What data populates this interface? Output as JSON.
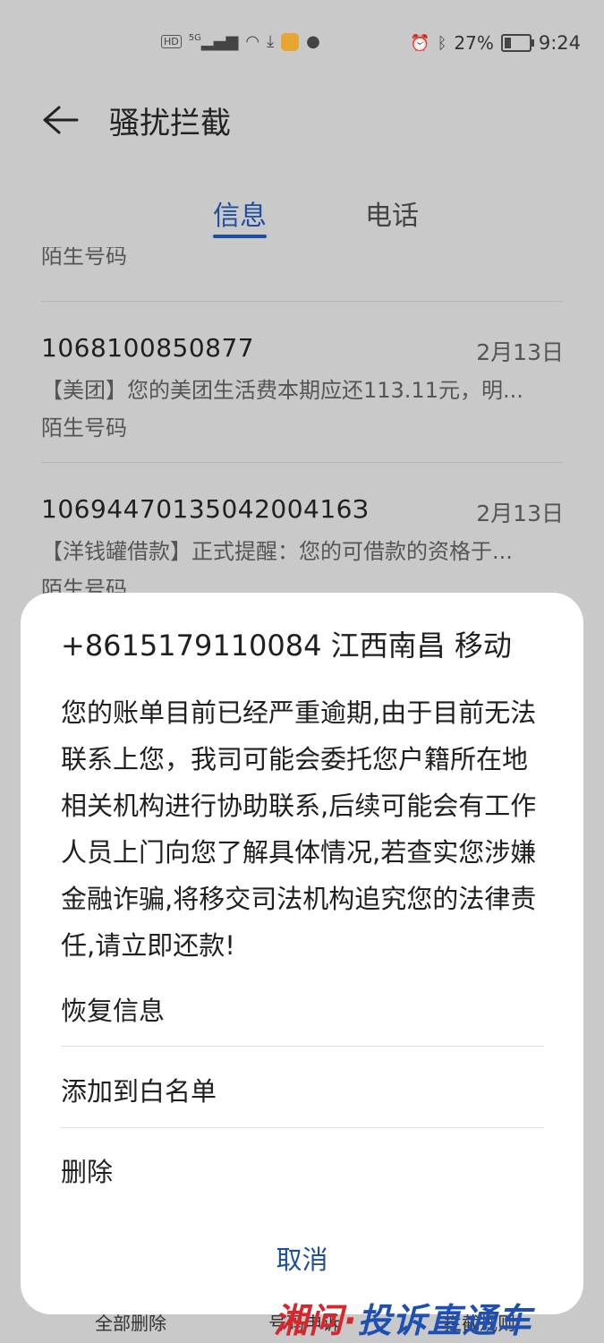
{
  "status_bar": {
    "left_icons": [
      "hd-badge",
      "5g-signal-icon",
      "wifi-icon",
      "download-icon",
      "app-notification-icon",
      "message-icon"
    ],
    "hd_label": "HD",
    "network": "5G",
    "battery_percent": "27%",
    "battery_level": 0.27,
    "time": "9:24"
  },
  "header": {
    "title": "骚扰拦截"
  },
  "tabs": [
    {
      "label": "信息",
      "selected": true
    },
    {
      "label": "电话",
      "selected": false
    }
  ],
  "list": {
    "partial_top_label": "陌生号码",
    "messages": [
      {
        "sender": "1068100850877",
        "date": "2月13日",
        "preview": "【美团】您的美团生活费本期应还113.11元，明...",
        "tag": "陌生号码"
      },
      {
        "sender": "1069447013504200416З",
        "date": "2月13日",
        "preview": "【洋钱罐借款】正式提醒：您的可借款的资格于...",
        "tag": "陌生号码"
      }
    ]
  },
  "bottom_bar": {
    "items": [
      "全部删除",
      "号码申诉",
      "拦截规则"
    ]
  },
  "sheet": {
    "title": "+8615179110084 江西南昌 移动",
    "body": "您的账单目前已经严重逾期,由于目前无法联系上您，我司可能会委托您户籍所在地相关机构进行协助联系,后续可能会有工作人员上门向您了解具体情况,若查实您涉嫌金融诈骗,将移交司法机构追究您的法律责任,请立即还款!",
    "actions": {
      "restore": "恢复信息",
      "whitelist": "添加到白名单",
      "delete": "删除"
    },
    "cancel": "取消"
  },
  "watermark": {
    "part1": "湘问·",
    "part2": "投诉直通车"
  },
  "colors": {
    "accent": "#1e4f9c",
    "dim_background": "#c9c9c9",
    "sheet_background": "#ffffff",
    "watermark_red": "#d8262d",
    "watermark_blue": "#1e4fb3"
  }
}
